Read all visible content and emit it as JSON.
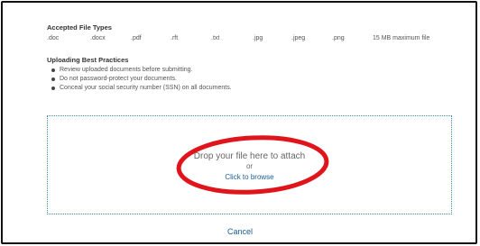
{
  "accepted_types": {
    "title": "Accepted File Types",
    "types": [
      ".doc",
      ".docx",
      ".pdf",
      ".rft",
      ".txt",
      ".jpg",
      ".jpeg",
      ".png"
    ],
    "max_size": "15 MB maximum file"
  },
  "best_practices": {
    "title": "Uploading Best Practices",
    "items": [
      "Review uploaded documents before submitting.",
      "Do not password-protect your documents.",
      "Conceal your social security number (SSN) on all documents."
    ]
  },
  "dropzone": {
    "main": "Drop your file here to attach",
    "or": "or",
    "browse": "Click to browse"
  },
  "cancel_label": "Cancel",
  "colors": {
    "link": "#1a5d8f",
    "dropzone_border": "#3a86a4",
    "annotation_circle": "#e0141b"
  }
}
